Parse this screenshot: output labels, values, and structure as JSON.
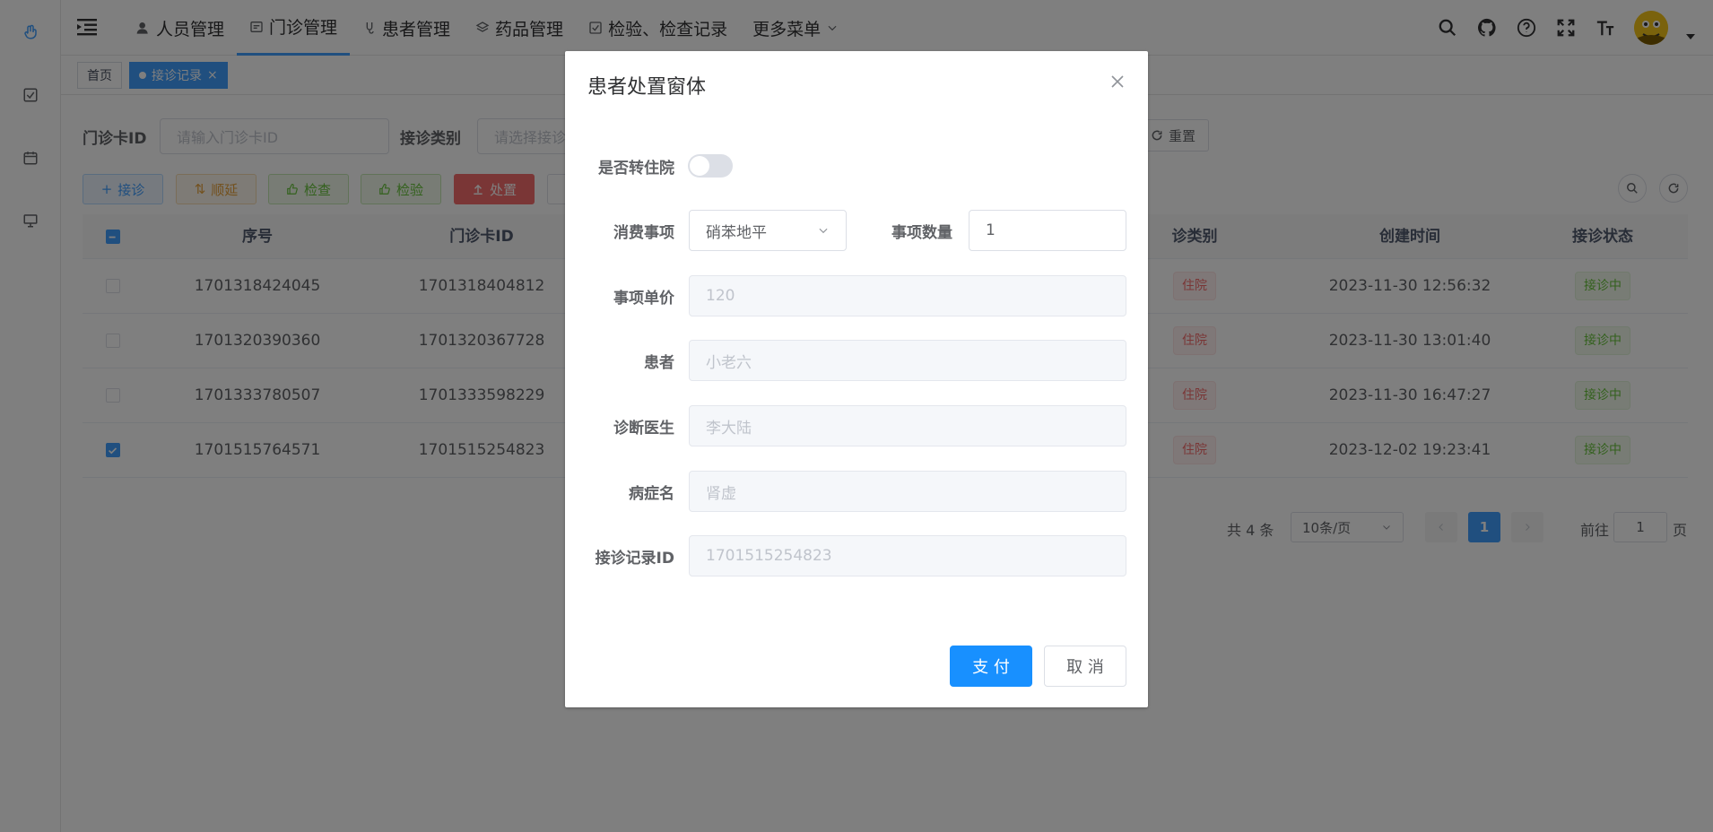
{
  "nav": {
    "items": [
      {
        "label": "人员管理",
        "icon": "user-icon"
      },
      {
        "label": "门诊管理",
        "icon": "clinic-icon"
      },
      {
        "label": "患者管理",
        "icon": "patient-icon"
      },
      {
        "label": "药品管理",
        "icon": "layers-icon"
      },
      {
        "label": "检验、检查记录",
        "icon": "checkbox-icon"
      },
      {
        "label": "更多菜单",
        "icon": "chevron-down-icon"
      }
    ]
  },
  "tags": {
    "home": "首页",
    "current": "接诊记录",
    "close": "×"
  },
  "filters": {
    "card_label": "门诊卡ID",
    "card_placeholder": "请输入门诊卡ID",
    "type_label": "接诊类别",
    "type_placeholder": "请选择接诊",
    "reset": "重置"
  },
  "toolbar": {
    "receive": "接诊",
    "delay": "顺延",
    "exam": "检查",
    "test": "检验",
    "handle": "处置"
  },
  "table": {
    "headers": {
      "seq": "序号",
      "card": "门诊卡ID",
      "type": "诊类别",
      "created": "创建时间",
      "status": "接诊状态"
    },
    "rows": [
      {
        "seq": "1701318424045",
        "card": "1701318404812",
        "type": "住院",
        "created": "2023-11-30 12:56:32",
        "status": "接诊中",
        "checked": false
      },
      {
        "seq": "1701320390360",
        "card": "1701320367728",
        "type": "住院",
        "created": "2023-11-30 13:01:40",
        "status": "接诊中",
        "checked": false
      },
      {
        "seq": "1701333780507",
        "card": "1701333598229",
        "type": "住院",
        "created": "2023-11-30 16:47:27",
        "status": "接诊中",
        "checked": false
      },
      {
        "seq": "1701515764571",
        "card": "1701515254823",
        "type": "住院",
        "created": "2023-12-02 19:23:41",
        "status": "接诊中",
        "checked": true
      }
    ]
  },
  "pager": {
    "total": "共 4 条",
    "size": "10条/页",
    "current": "1",
    "goto": "前往",
    "goto_value": "1",
    "page_unit": "页"
  },
  "modal": {
    "title": "患者处置窗体",
    "transfer_label": "是否转住院",
    "item_label": "消费事项",
    "item_value": "硝苯地平",
    "qty_label": "事项数量",
    "qty_value": "1",
    "price_label": "事项单价",
    "price_value": "120",
    "patient_label": "患者",
    "patient_value": "小老六",
    "doctor_label": "诊断医生",
    "doctor_value": "李大陆",
    "disease_label": "病症名",
    "disease_value": "肾虚",
    "record_label": "接诊记录ID",
    "record_value": "1701515254823",
    "pay": "支 付",
    "cancel": "取 消"
  },
  "colors": {
    "primary": "#409eff",
    "danger": "#f56c6c",
    "success": "#67c23a",
    "warning": "#e6a23c"
  }
}
